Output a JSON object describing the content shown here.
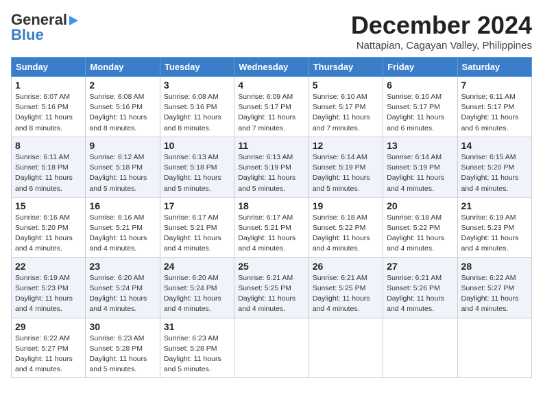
{
  "logo": {
    "line1": "General",
    "line2": "Blue"
  },
  "title": "December 2024",
  "location": "Nattapian, Cagayan Valley, Philippines",
  "days_header": [
    "Sunday",
    "Monday",
    "Tuesday",
    "Wednesday",
    "Thursday",
    "Friday",
    "Saturday"
  ],
  "weeks": [
    [
      {
        "day": "1",
        "info": "Sunrise: 6:07 AM\nSunset: 5:16 PM\nDaylight: 11 hours and 8 minutes."
      },
      {
        "day": "2",
        "info": "Sunrise: 6:08 AM\nSunset: 5:16 PM\nDaylight: 11 hours and 8 minutes."
      },
      {
        "day": "3",
        "info": "Sunrise: 6:08 AM\nSunset: 5:16 PM\nDaylight: 11 hours and 8 minutes."
      },
      {
        "day": "4",
        "info": "Sunrise: 6:09 AM\nSunset: 5:17 PM\nDaylight: 11 hours and 7 minutes."
      },
      {
        "day": "5",
        "info": "Sunrise: 6:10 AM\nSunset: 5:17 PM\nDaylight: 11 hours and 7 minutes."
      },
      {
        "day": "6",
        "info": "Sunrise: 6:10 AM\nSunset: 5:17 PM\nDaylight: 11 hours and 6 minutes."
      },
      {
        "day": "7",
        "info": "Sunrise: 6:11 AM\nSunset: 5:17 PM\nDaylight: 11 hours and 6 minutes."
      }
    ],
    [
      {
        "day": "8",
        "info": "Sunrise: 6:11 AM\nSunset: 5:18 PM\nDaylight: 11 hours and 6 minutes."
      },
      {
        "day": "9",
        "info": "Sunrise: 6:12 AM\nSunset: 5:18 PM\nDaylight: 11 hours and 5 minutes."
      },
      {
        "day": "10",
        "info": "Sunrise: 6:13 AM\nSunset: 5:18 PM\nDaylight: 11 hours and 5 minutes."
      },
      {
        "day": "11",
        "info": "Sunrise: 6:13 AM\nSunset: 5:19 PM\nDaylight: 11 hours and 5 minutes."
      },
      {
        "day": "12",
        "info": "Sunrise: 6:14 AM\nSunset: 5:19 PM\nDaylight: 11 hours and 5 minutes."
      },
      {
        "day": "13",
        "info": "Sunrise: 6:14 AM\nSunset: 5:19 PM\nDaylight: 11 hours and 4 minutes."
      },
      {
        "day": "14",
        "info": "Sunrise: 6:15 AM\nSunset: 5:20 PM\nDaylight: 11 hours and 4 minutes."
      }
    ],
    [
      {
        "day": "15",
        "info": "Sunrise: 6:16 AM\nSunset: 5:20 PM\nDaylight: 11 hours and 4 minutes."
      },
      {
        "day": "16",
        "info": "Sunrise: 6:16 AM\nSunset: 5:21 PM\nDaylight: 11 hours and 4 minutes."
      },
      {
        "day": "17",
        "info": "Sunrise: 6:17 AM\nSunset: 5:21 PM\nDaylight: 11 hours and 4 minutes."
      },
      {
        "day": "18",
        "info": "Sunrise: 6:17 AM\nSunset: 5:21 PM\nDaylight: 11 hours and 4 minutes."
      },
      {
        "day": "19",
        "info": "Sunrise: 6:18 AM\nSunset: 5:22 PM\nDaylight: 11 hours and 4 minutes."
      },
      {
        "day": "20",
        "info": "Sunrise: 6:18 AM\nSunset: 5:22 PM\nDaylight: 11 hours and 4 minutes."
      },
      {
        "day": "21",
        "info": "Sunrise: 6:19 AM\nSunset: 5:23 PM\nDaylight: 11 hours and 4 minutes."
      }
    ],
    [
      {
        "day": "22",
        "info": "Sunrise: 6:19 AM\nSunset: 5:23 PM\nDaylight: 11 hours and 4 minutes."
      },
      {
        "day": "23",
        "info": "Sunrise: 6:20 AM\nSunset: 5:24 PM\nDaylight: 11 hours and 4 minutes."
      },
      {
        "day": "24",
        "info": "Sunrise: 6:20 AM\nSunset: 5:24 PM\nDaylight: 11 hours and 4 minutes."
      },
      {
        "day": "25",
        "info": "Sunrise: 6:21 AM\nSunset: 5:25 PM\nDaylight: 11 hours and 4 minutes."
      },
      {
        "day": "26",
        "info": "Sunrise: 6:21 AM\nSunset: 5:25 PM\nDaylight: 11 hours and 4 minutes."
      },
      {
        "day": "27",
        "info": "Sunrise: 6:21 AM\nSunset: 5:26 PM\nDaylight: 11 hours and 4 minutes."
      },
      {
        "day": "28",
        "info": "Sunrise: 6:22 AM\nSunset: 5:27 PM\nDaylight: 11 hours and 4 minutes."
      }
    ],
    [
      {
        "day": "29",
        "info": "Sunrise: 6:22 AM\nSunset: 5:27 PM\nDaylight: 11 hours and 4 minutes."
      },
      {
        "day": "30",
        "info": "Sunrise: 6:23 AM\nSunset: 5:28 PM\nDaylight: 11 hours and 5 minutes."
      },
      {
        "day": "31",
        "info": "Sunrise: 6:23 AM\nSunset: 5:28 PM\nDaylight: 11 hours and 5 minutes."
      },
      null,
      null,
      null,
      null
    ]
  ]
}
